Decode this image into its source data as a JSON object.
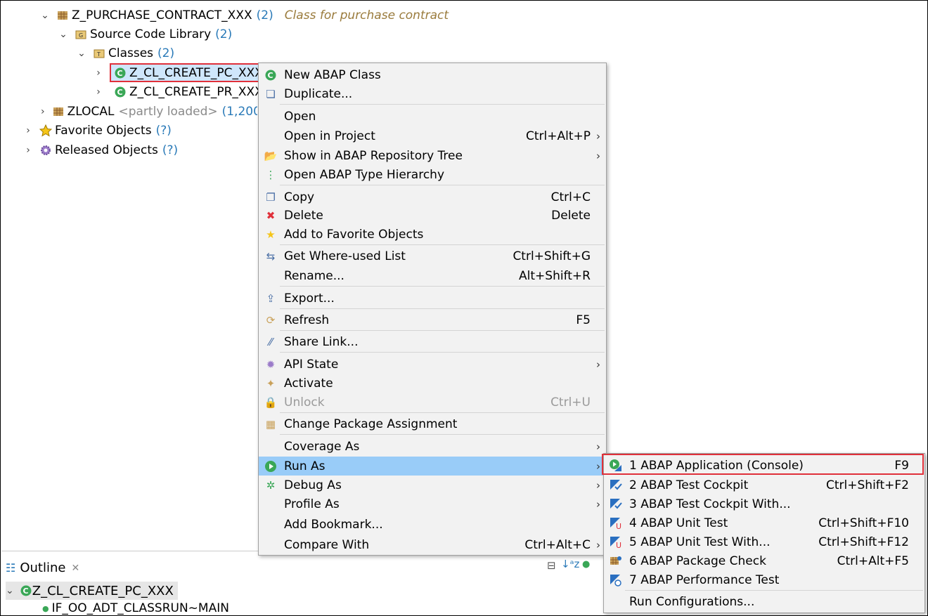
{
  "tree": {
    "items": [
      {
        "label": "Z_PURCHASE_CONTRACT_XXX",
        "count": "(2)",
        "desc": "Class for purchase contract",
        "icon": "package-icon"
      },
      {
        "label": "Source Code Library",
        "count": "(2)",
        "icon": "folder-icon"
      },
      {
        "label": "Classes",
        "count": "(2)",
        "icon": "folder-icon"
      },
      {
        "label": "Z_CL_CREATE_PC_XXX",
        "icon": "class-icon"
      },
      {
        "label": "Z_CL_CREATE_PR_XXX",
        "icon": "class-icon"
      },
      {
        "label": "ZLOCAL",
        "partial": "<partly loaded>",
        "count": "(1,200",
        "icon": "package-icon"
      },
      {
        "label": "Favorite Objects",
        "count": "(?)",
        "icon": "star-icon"
      },
      {
        "label": "Released Objects",
        "count": "(?)",
        "icon": "gear-icon"
      }
    ]
  },
  "context_menu": {
    "items": [
      {
        "label": "New ABAP Class",
        "shortcut": "",
        "icon": "new-class-icon"
      },
      {
        "label": "Duplicate...",
        "shortcut": "",
        "icon": "duplicate-icon"
      },
      {
        "label": "Open",
        "shortcut": ""
      },
      {
        "label": "Open in Project",
        "shortcut": "Ctrl+Alt+P",
        "arrow": true
      },
      {
        "label": "Show in ABAP Repository Tree",
        "shortcut": "",
        "arrow": true,
        "icon": "folder-open-icon"
      },
      {
        "label": "Open ABAP Type Hierarchy",
        "shortcut": "",
        "icon": "hierarchy-icon"
      },
      {
        "label": "Copy",
        "shortcut": "Ctrl+C",
        "icon": "copy-icon"
      },
      {
        "label": "Delete",
        "shortcut": "Delete",
        "icon": "delete-icon"
      },
      {
        "label": "Add to Favorite Objects",
        "shortcut": "",
        "icon": "star-icon"
      },
      {
        "label": "Get Where-used List",
        "shortcut": "Ctrl+Shift+G",
        "icon": "where-used-icon"
      },
      {
        "label": "Rename...",
        "shortcut": "Alt+Shift+R"
      },
      {
        "label": "Export...",
        "shortcut": "",
        "icon": "export-icon"
      },
      {
        "label": "Refresh",
        "shortcut": "F5",
        "icon": "refresh-icon"
      },
      {
        "label": "Share Link...",
        "shortcut": "",
        "icon": "link-icon"
      },
      {
        "label": "API State",
        "shortcut": "",
        "arrow": true,
        "icon": "api-state-icon"
      },
      {
        "label": "Activate",
        "shortcut": "",
        "icon": "activate-icon"
      },
      {
        "label": "Unlock",
        "shortcut": "Ctrl+U",
        "disabled": true,
        "icon": "lock-icon"
      },
      {
        "label": "Change Package Assignment",
        "shortcut": "",
        "icon": "package-icon"
      },
      {
        "label": "Coverage As",
        "shortcut": "",
        "arrow": true
      },
      {
        "label": "Run As",
        "shortcut": "",
        "arrow": true,
        "icon": "run-icon",
        "highlight": true
      },
      {
        "label": "Debug As",
        "shortcut": "",
        "arrow": true,
        "icon": "debug-icon"
      },
      {
        "label": "Profile As",
        "shortcut": "",
        "arrow": true
      },
      {
        "label": "Add Bookmark...",
        "shortcut": ""
      },
      {
        "label": "Compare With",
        "shortcut": "Ctrl+Alt+C",
        "arrow": true
      }
    ]
  },
  "submenu": {
    "items": [
      {
        "label": "1 ABAP Application (Console)",
        "shortcut": "F9",
        "icon": "run-console-icon"
      },
      {
        "label": "2 ABAP Test Cockpit",
        "shortcut": "Ctrl+Shift+F2",
        "icon": "atc-icon"
      },
      {
        "label": "3 ABAP Test Cockpit With...",
        "shortcut": "",
        "icon": "atc-icon"
      },
      {
        "label": "4 ABAP Unit Test",
        "shortcut": "Ctrl+Shift+F10",
        "icon": "unit-test-icon"
      },
      {
        "label": "5 ABAP Unit Test With...",
        "shortcut": "Ctrl+Shift+F12",
        "icon": "unit-test-icon"
      },
      {
        "label": "6 ABAP Package Check",
        "shortcut": "Ctrl+Alt+F5",
        "icon": "package-check-icon"
      },
      {
        "label": "7 ABAP Performance Test",
        "shortcut": "",
        "icon": "performance-icon"
      },
      {
        "label": "Run Configurations...",
        "shortcut": ""
      }
    ]
  },
  "outline": {
    "tab_label": "Outline",
    "root": "Z_CL_CREATE_PC_XXX",
    "child": "IF_OO_ADT_CLASSRUN~MAIN"
  },
  "colors": {
    "highlight": "#99ccf8",
    "accent_red": "#e0303a",
    "count_blue": "#2a7ab8"
  }
}
